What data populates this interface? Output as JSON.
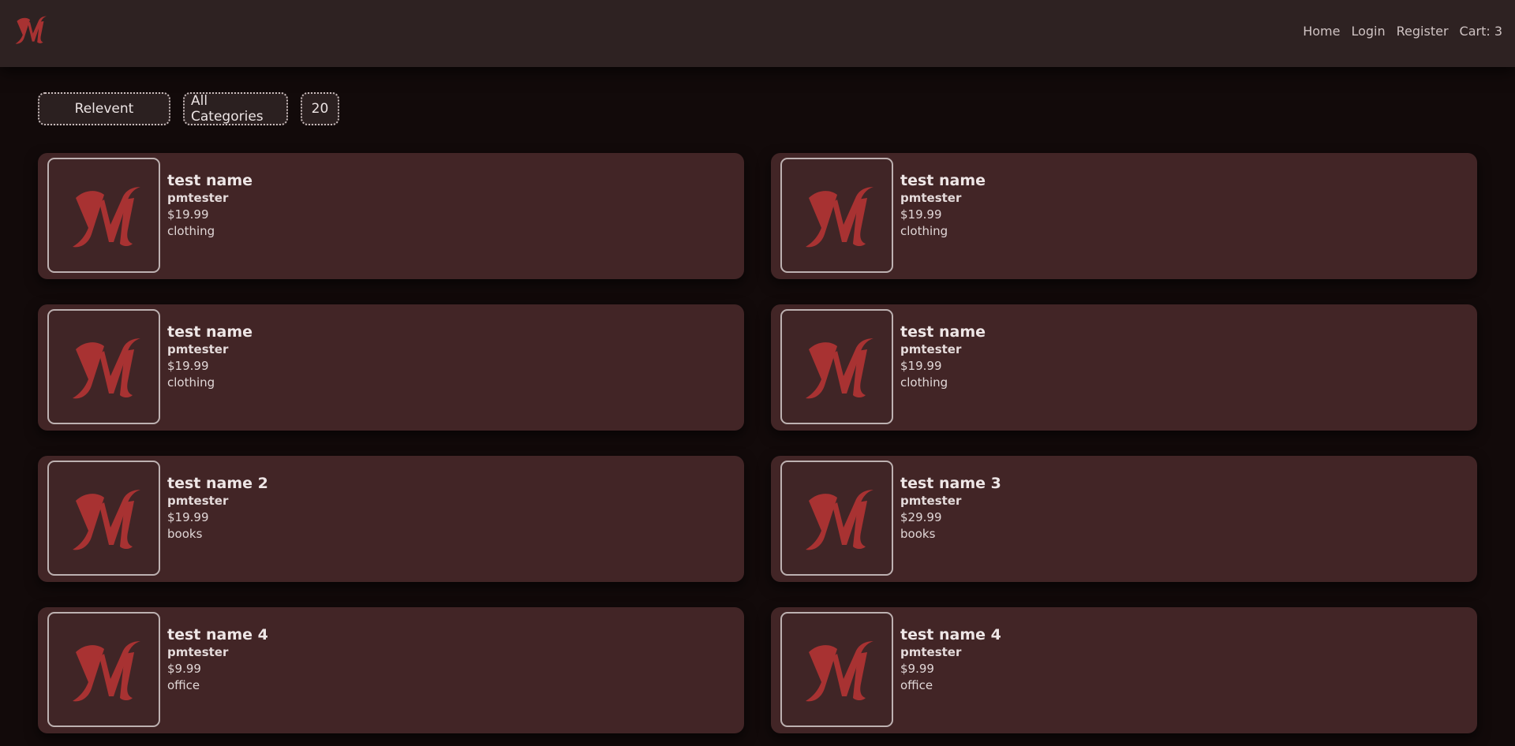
{
  "brand": {
    "logo_icon": "m-monogram-logo-icon",
    "accent": "#a83232"
  },
  "nav": {
    "home": "Home",
    "login": "Login",
    "register": "Register",
    "cart": "Cart: 3"
  },
  "filters": {
    "sort": "Relevent",
    "category": "All Categories",
    "per_page": "20"
  },
  "products": [
    {
      "name": "test name",
      "seller": "pmtester",
      "price": "$19.99",
      "category": "clothing"
    },
    {
      "name": "test name",
      "seller": "pmtester",
      "price": "$19.99",
      "category": "clothing"
    },
    {
      "name": "test name",
      "seller": "pmtester",
      "price": "$19.99",
      "category": "clothing"
    },
    {
      "name": "test name",
      "seller": "pmtester",
      "price": "$19.99",
      "category": "clothing"
    },
    {
      "name": "test name 2",
      "seller": "pmtester",
      "price": "$19.99",
      "category": "books"
    },
    {
      "name": "test name 3",
      "seller": "pmtester",
      "price": "$29.99",
      "category": "books"
    },
    {
      "name": "test name 4",
      "seller": "pmtester",
      "price": "$9.99",
      "category": "office"
    },
    {
      "name": "test name 4",
      "seller": "pmtester",
      "price": "$9.99",
      "category": "office"
    }
  ]
}
